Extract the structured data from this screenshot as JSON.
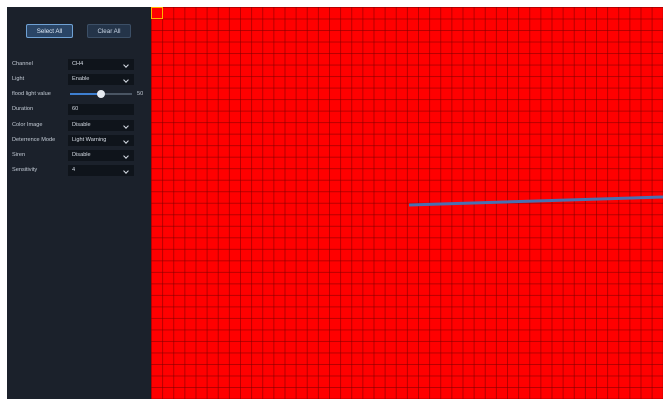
{
  "buttons": {
    "select_all": "Select All",
    "clear_all": "Clear All"
  },
  "settings": {
    "channel": {
      "label": "Channel",
      "value": "CH4"
    },
    "light": {
      "label": "Light",
      "value": "Enable"
    },
    "flood_light": {
      "label": "flood light value",
      "value": "50",
      "level": 0.5
    },
    "duration": {
      "label": "Duration",
      "value": "60"
    },
    "color_image": {
      "label": "Color Image",
      "value": "Disable"
    },
    "deterrence_mode": {
      "label": "Deterrence Mode",
      "value": "Light Warning"
    },
    "siren": {
      "label": "Siren",
      "value": "Disable"
    },
    "sensitivity": {
      "label": "Sensitivity",
      "value": "4"
    }
  },
  "colors": {
    "sidebar_bg": "#1b212b",
    "detection_area": "#ff0000",
    "line": "#4a6fb0",
    "marker": "#ffb000"
  }
}
